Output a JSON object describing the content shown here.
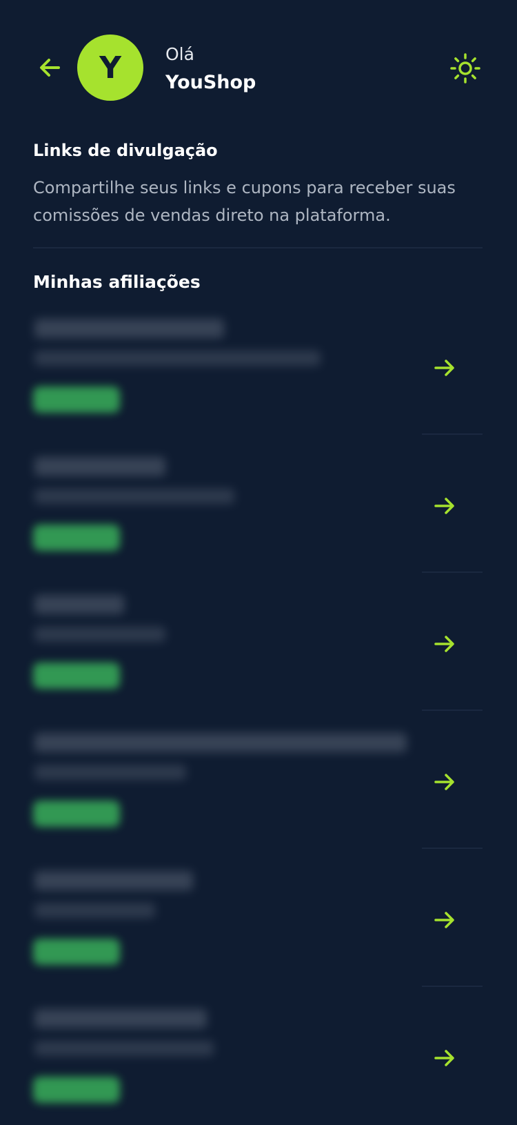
{
  "header": {
    "greeting": "Olá",
    "store_name": "YouShop",
    "avatar_letter": "Y",
    "back_icon": "arrow-left-icon",
    "theme_icon": "sun-icon"
  },
  "links_section": {
    "title": "Links de divulgação",
    "description": "Compartilhe seus links e cupons para receber suas comissões de vendas direto na plataforma."
  },
  "affiliations_section": {
    "title": "Minhas afiliações",
    "items_note": "6 affiliation rows; their text and status badges are blurred/unreadable in the screenshot",
    "item_icon": "arrow-right-icon"
  },
  "colors": {
    "background": "#0f1c31",
    "accent": "#a6e22e",
    "status_badge": "#3ec25f",
    "muted_text": "#aeb6c2"
  }
}
